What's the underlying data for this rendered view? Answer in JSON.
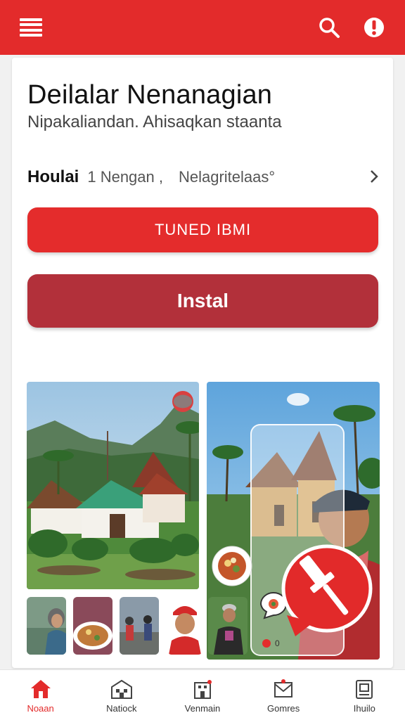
{
  "colors": {
    "brand_red": "#e32b2b",
    "install_red": "#b2303a",
    "background": "#f1f1f1"
  },
  "app_bar": {
    "menu_icon": "hamburger-menu-icon",
    "search_icon": "search-icon",
    "alert_icon": "alert-icon"
  },
  "header": {
    "title": "Deilalar Nenanagian",
    "subtitle": "Nipakaliandan. Ahisaqkan staanta"
  },
  "info_row": {
    "primary": "Houlai",
    "secondary": "1 Nengan ,",
    "tertiary": "Nelagritelaas°"
  },
  "buttons": {
    "primary_label": "TUNED IBMI",
    "install_label": "Instal"
  },
  "gallery": {
    "counter": "0"
  },
  "bottom_nav": {
    "items": [
      {
        "label": "Noaan",
        "icon": "home-icon",
        "active": true
      },
      {
        "label": "Natiock",
        "icon": "building-icon",
        "active": false
      },
      {
        "label": "Venmain",
        "icon": "store-icon",
        "active": false
      },
      {
        "label": "Gomres",
        "icon": "inbox-icon",
        "active": false
      },
      {
        "label": "Ihuilo",
        "icon": "profile-card-icon",
        "active": false
      }
    ]
  }
}
